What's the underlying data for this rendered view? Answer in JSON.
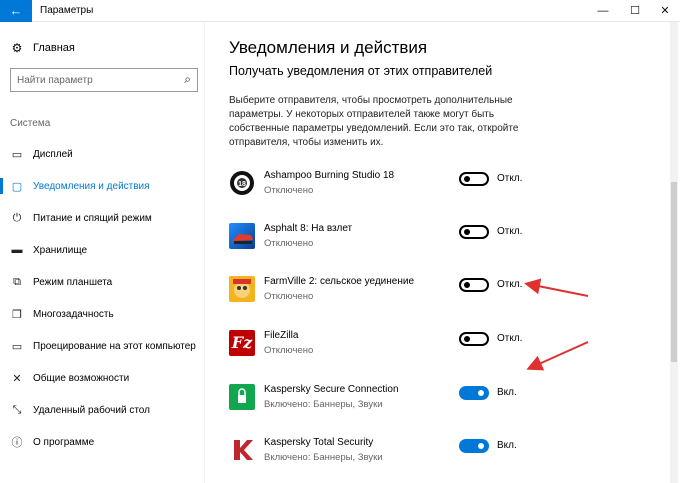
{
  "window": {
    "title": "Параметры",
    "back_glyph": "←",
    "min_glyph": "—",
    "max_glyph": "☐",
    "close_glyph": "✕"
  },
  "sidebar": {
    "home_label": "Главная",
    "search_placeholder": "Найти параметр",
    "section_label": "Система",
    "items": [
      {
        "label": "Дисплей",
        "icon": "display-icon",
        "active": false
      },
      {
        "label": "Уведомления и действия",
        "icon": "notifications-icon",
        "active": true
      },
      {
        "label": "Питание и спящий режим",
        "icon": "power-icon",
        "active": false
      },
      {
        "label": "Хранилище",
        "icon": "storage-icon",
        "active": false
      },
      {
        "label": "Режим планшета",
        "icon": "tablet-icon",
        "active": false
      },
      {
        "label": "Многозадачность",
        "icon": "multitasking-icon",
        "active": false
      },
      {
        "label": "Проецирование на этот компьютер",
        "icon": "projecting-icon",
        "active": false
      },
      {
        "label": "Общие возможности",
        "icon": "shared-experiences-icon",
        "active": false
      },
      {
        "label": "Удаленный рабочий стол",
        "icon": "remote-desktop-icon",
        "active": false
      },
      {
        "label": "О программе",
        "icon": "about-icon",
        "active": false
      }
    ]
  },
  "main": {
    "title": "Уведомления и действия",
    "subtitle": "Получать уведомления от этих отправителей",
    "description": "Выберите отправителя, чтобы просмотреть дополнительные параметры. У некоторых отправителей также могут быть собственные параметры уведомлений. Если это так, откройте отправителя, чтобы изменить их.",
    "apps": [
      {
        "name": "Ashampoo Burning Studio 18",
        "status": "Отключено",
        "toggle_label": "Откл.",
        "on": false
      },
      {
        "name": "Asphalt 8: На взлет",
        "status": "Отключено",
        "toggle_label": "Откл.",
        "on": false
      },
      {
        "name": "FarmVille 2: сельское уединение",
        "status": "Отключено",
        "toggle_label": "Откл.",
        "on": false
      },
      {
        "name": "FileZilla",
        "status": "Отключено",
        "toggle_label": "Откл.",
        "on": false
      },
      {
        "name": "Kaspersky Secure Connection",
        "status": "Включено: Баннеры, Звуки",
        "toggle_label": "Вкл.",
        "on": true
      },
      {
        "name": "Kaspersky Total Security",
        "status": "Включено: Баннеры, Звуки",
        "toggle_label": "Вкл.",
        "on": true
      }
    ]
  },
  "colors": {
    "accent": "#0078d7",
    "annotation_arrow": "#e03030"
  }
}
